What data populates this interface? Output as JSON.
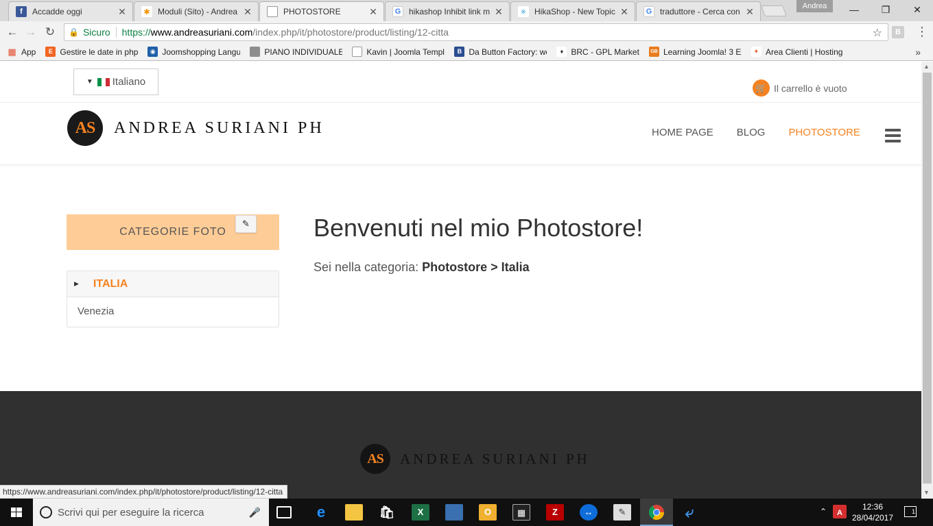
{
  "browser": {
    "tabs": [
      {
        "label": "Accadde oggi",
        "icon": "facebook-icon",
        "icon_color": "#3b5998",
        "icon_char": "f"
      },
      {
        "label": "Moduli (Sito) - Andrea",
        "icon": "joomla-icon",
        "icon_color": "#f39200",
        "icon_char": "✱"
      },
      {
        "label": "PHOTOSTORE",
        "icon": "page-icon",
        "icon_color": "#ffffff",
        "icon_char": "▯"
      },
      {
        "label": "hikashop Inhibit link m",
        "icon": "google-icon",
        "icon_color": "#ffffff",
        "icon_char": "G"
      },
      {
        "label": "HikaShop - New Topic",
        "icon": "hikashop-icon",
        "icon_color": "#ffffff",
        "icon_char": "✳"
      },
      {
        "label": "traduttore - Cerca con",
        "icon": "google-icon",
        "icon_color": "#ffffff",
        "icon_char": "G"
      }
    ],
    "tab_close": "✕",
    "profile": "Andrea",
    "address": {
      "secure_label": "Sicuro",
      "url_scheme": "https://",
      "url_host": "www.andreasuriani.com",
      "url_path": "/index.php/it/photostore/product/listing/12-citta"
    },
    "extension_label": "B",
    "bookmarks": [
      {
        "label": "App",
        "icon": "apps-grid-icon",
        "color": "#e24b2b",
        "char": "⋮"
      },
      {
        "label": "Gestire le date in php",
        "icon": "bookmark-orange-icon",
        "color": "#f26522",
        "char": "E"
      },
      {
        "label": "Joomshopping Langu",
        "icon": "joomshopping-icon",
        "color": "#1f5fa8",
        "char": "◉"
      },
      {
        "label": "PIANO INDIVIDUALE",
        "icon": "folder-icon",
        "color": "#8d8d8d",
        "char": "▬"
      },
      {
        "label": "Kavin | Joomla Templa",
        "icon": "page-icon",
        "color": "#ffffff",
        "char": "▯"
      },
      {
        "label": "Da Button Factory: we",
        "icon": "button-factory-icon",
        "color": "#2a4d8f",
        "char": "B"
      },
      {
        "label": "BRC - GPL Market",
        "icon": "gpl-market-icon",
        "color": "#ffffff",
        "char": "♦"
      },
      {
        "label": "Learning Joomla! 3 Ex",
        "icon": "gb-icon",
        "color": "#e87c1e",
        "char": "GB"
      },
      {
        "label": "Area Clienti | Hosting",
        "icon": "hosting-icon",
        "color": "#ffffff",
        "char": "✦"
      }
    ],
    "bookmarks_more": "»",
    "status_url": "https://www.andreasuriani.com/index.php/it/photostore/product/listing/12-citta"
  },
  "site": {
    "language": "Italiano",
    "cart": "Il carrello è vuoto",
    "logo_initials": "AS",
    "logo_text": "ANDREA SURIANI PH",
    "nav": [
      {
        "label": "HOME PAGE",
        "active": false
      },
      {
        "label": "BLOG",
        "active": false
      },
      {
        "label": "PHOTOSTORE",
        "active": true
      }
    ],
    "accent_color": "#f58220",
    "sidebar": {
      "title": "CATEGORIE FOTO",
      "parent_category": "ITALIA",
      "child_category": "Venezia"
    },
    "main": {
      "heading": "Benvenuti nel mio Photostore!",
      "category_prefix": "Sei nella categoria:",
      "category_path": "Photostore > Italia"
    }
  },
  "taskbar": {
    "search_placeholder": "Scrivi qui per eseguire la ricerca",
    "time": "12:36",
    "date": "28/04/2017",
    "notifications": "1"
  }
}
